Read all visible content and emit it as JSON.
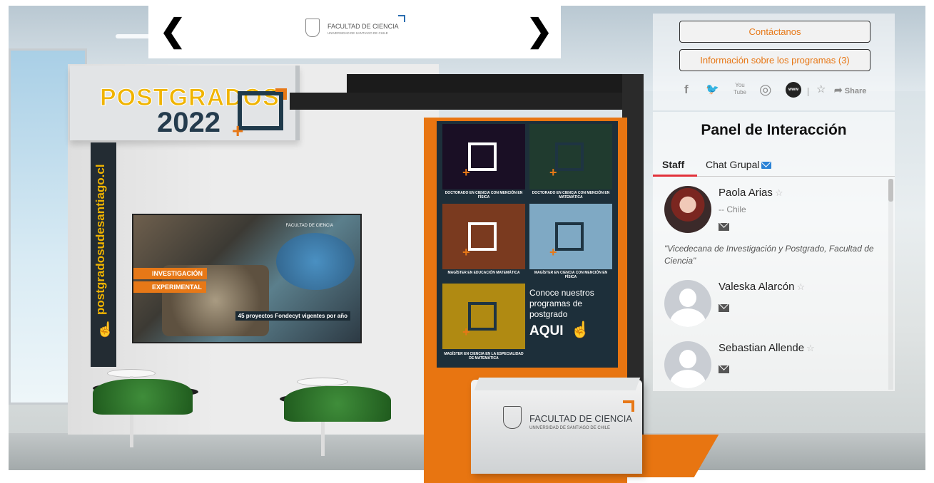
{
  "booth": {
    "header_title": "POSTGRADOS",
    "header_year": "2022",
    "header_plus": "+",
    "vertical_url": "postgradosudesantiago.cl",
    "screen_tag_1": "INVESTIGACIÓN",
    "screen_tag_2": "EXPERIMENTAL",
    "screen_caption": "45 proyectos Fondecyt vigentes por año",
    "screen_logo": "FACULTAD DE CIENCIA",
    "counter_name": "FACULTAD DE CIENCIA",
    "counter_sub": "UNIVERSIDAD DE SANTIAGO DE CHILE",
    "tiles": [
      {
        "caption": "DOCTORADO EN CIENCIA CON MENCIÓN EN FÍSICA",
        "bg": "#1a0f25"
      },
      {
        "caption": "DOCTORADO EN CIENCIA CON MENCIÓN EN MATEMÁTICA",
        "bg": "#203b2f"
      },
      {
        "caption": "MAGÍSTER EN EDUCACIÓN MATEMÁTICA",
        "bg": "#7a3a1f"
      },
      {
        "caption": "MAGÍSTER EN CIENCIA CON MENCIÓN EN FÍSICA",
        "bg": "#7fa9c4"
      },
      {
        "caption": "MAGÍSTER EN CIENCIA EN LA ESPECIALIDAD DE MATEMÁTICA",
        "bg": "#b08a12"
      }
    ],
    "cta_line1": "Conoce nuestros",
    "cta_line2": "programas de",
    "cta_line3": "postgrado",
    "cta_aqui": "AQUI"
  },
  "topbar": {
    "prev_label": "❮",
    "next_label": "❯",
    "logo_name": "FACULTAD DE CIENCIA",
    "logo_sub": "UNIVERSIDAD DE SANTIAGO DE CHILE"
  },
  "sidebar": {
    "contact_label": "Contáctanos",
    "programs_label": "Información sobre los programas (3)",
    "social": [
      {
        "name": "facebook-icon",
        "glyph": "f"
      },
      {
        "name": "twitter-icon",
        "glyph": "🐦"
      },
      {
        "name": "youtube-icon",
        "glyph": "▣"
      },
      {
        "name": "instagram-icon",
        "glyph": "◎"
      },
      {
        "name": "website-icon",
        "glyph": "www"
      }
    ],
    "share_label": "Share",
    "panel_title": "Panel de Interacción",
    "tab_staff": "Staff",
    "tab_chat": "Chat Grupal",
    "staff": [
      {
        "name": "Paola Arias",
        "location": "-- Chile",
        "quote": "\"Vicedecana de Investigación y Postgrado, Facultad de Ciencia\""
      },
      {
        "name": "Valeska Alarcón"
      },
      {
        "name": "Sebastian Allende"
      }
    ]
  },
  "colors": {
    "accent_orange": "#e77817",
    "brand_navy": "#1f3a4b",
    "brand_yellow": "#f0b400",
    "tab_active": "#e2323b",
    "mail_blue": "#2a82d6"
  }
}
